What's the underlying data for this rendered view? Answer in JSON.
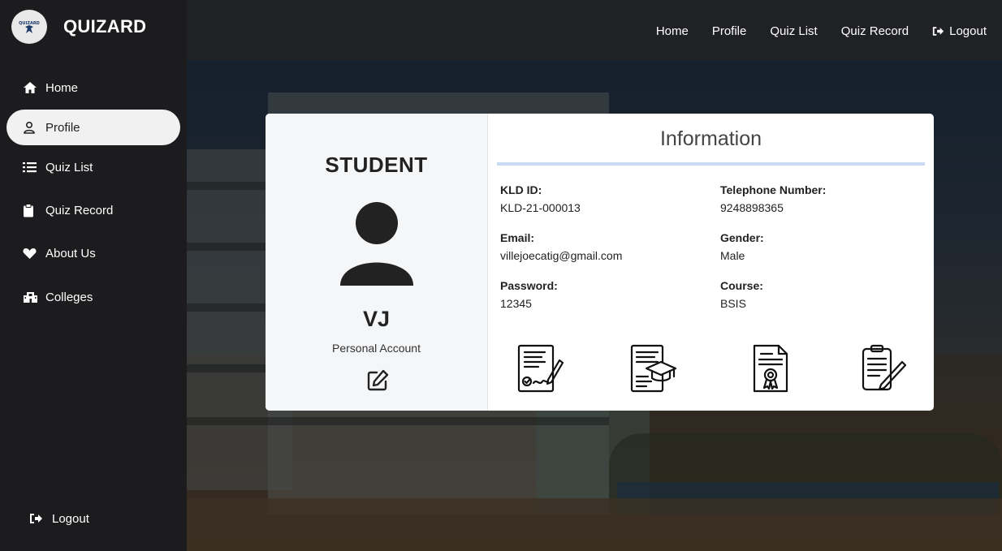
{
  "brand": {
    "title": "QUIZARD",
    "logo_text": "QUIZARD",
    "logo_icon": "wizard-logo"
  },
  "sidebar": {
    "items": [
      {
        "label": "Home",
        "icon": "home-icon"
      },
      {
        "label": "Profile",
        "icon": "user-icon",
        "active": true
      },
      {
        "label": "Quiz List",
        "icon": "list-icon"
      },
      {
        "label": "Quiz Record",
        "icon": "clipboard-icon"
      },
      {
        "label": "About Us",
        "icon": "heart-icon"
      },
      {
        "label": "Colleges",
        "icon": "building-icon"
      }
    ],
    "logout_label": "Logout"
  },
  "topnav": {
    "items": [
      "Home",
      "Profile",
      "Quiz List",
      "Quiz Record"
    ],
    "logout_label": "Logout"
  },
  "profile": {
    "role": "STUDENT",
    "username": "VJ",
    "account_type": "Personal Account"
  },
  "info": {
    "title": "Information",
    "fields": [
      {
        "label": "KLD ID:",
        "value": "KLD-21-000013"
      },
      {
        "label": "Telephone Number:",
        "value": "9248898365"
      },
      {
        "label": "Email:",
        "value": "villejoecatig@gmail.com"
      },
      {
        "label": "Gender:",
        "value": "Male"
      },
      {
        "label": "Password:",
        "value": "12345"
      },
      {
        "label": "Course:",
        "value": "BSIS"
      }
    ],
    "illustrations": [
      "contract-sign-icon",
      "graduation-document-icon",
      "certificate-icon",
      "exam-pen-icon"
    ]
  },
  "colors": {
    "sidebar_bg": "#1c1c1e",
    "topbar_bg": "#202124",
    "rule": "#c9daf3",
    "active_bg": "#f1f1f1"
  }
}
